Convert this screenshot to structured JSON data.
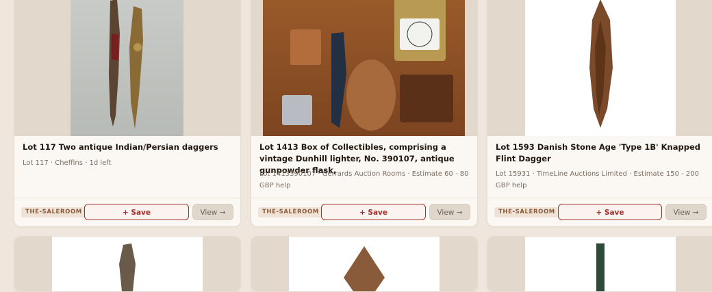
{
  "cards": [
    {
      "title": "Lot 117 Two antique Indian/Persian daggers",
      "meta": "Lot 117 · Cheffins · 1d left",
      "badge": "THE-SALEROOM",
      "save": "+ Save",
      "view": "View →"
    },
    {
      "title": "Lot 1413 Box of Collectibles, comprising a vintage Dunhill lighter, No. 390107, antique gunpowder flask,",
      "meta": "Lot 1413390107 · Gerrards Auction Rooms · Estimate 60 - 80 GBP help",
      "badge": "THE-SALEROOM",
      "save": "+ Save",
      "view": "View →"
    },
    {
      "title": "Lot 1593 Danish Stone Age 'Type 1B' Knapped Flint Dagger",
      "meta": "Lot 15931 · TimeLine Auctions Limited · Estimate 150 - 200 GBP help",
      "badge": "THE-SALEROOM",
      "save": "+ Save",
      "view": "View →"
    }
  ],
  "colors": {
    "accent": "#a2302a",
    "page_bg": "#efe7dd",
    "card_bg": "#fbf8f4"
  }
}
